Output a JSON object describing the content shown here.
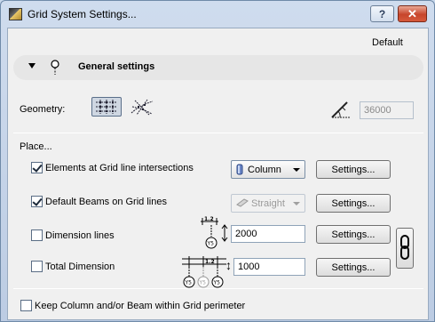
{
  "window": {
    "title": "Grid System Settings...",
    "help_label": "?",
    "close_label": "✕"
  },
  "header": {
    "default_label": "Default"
  },
  "section": {
    "title": "General settings"
  },
  "geometry": {
    "label": "Geometry:",
    "angle_value": "36000"
  },
  "place": {
    "label": "Place...",
    "elements_intersections": {
      "label": "Elements at Grid line intersections",
      "checked": true,
      "type_value": "Column",
      "settings_label": "Settings..."
    },
    "default_beams": {
      "label": "Default Beams on Grid lines",
      "checked": true,
      "type_value": "Straight",
      "settings_label": "Settings..."
    },
    "dimension_lines": {
      "label": "Dimension lines",
      "checked": false,
      "offset_value": "2000",
      "settings_label": "Settings...",
      "icon_dim": "1.2",
      "icon_tag": "Y5"
    },
    "total_dimension": {
      "label": "Total Dimension",
      "checked": false,
      "offset_value": "1000",
      "settings_label": "Settings...",
      "icon_dim": "1.2",
      "icon_tag": "Y5"
    }
  },
  "keep_within": {
    "label": "Keep Column and/or Beam within Grid perimeter",
    "checked": false
  },
  "colors": {
    "accent": "#c7452b",
    "panel": "#f0f0f0",
    "frame": "#bccce3"
  },
  "icons": [
    "app-icon",
    "help-icon",
    "close-icon",
    "collapse-triangle-icon",
    "pin-icon",
    "orthogonal-grid-icon",
    "polar-grid-icon",
    "angle-icon",
    "column-icon",
    "beam-icon",
    "dimension-icon",
    "total-dimension-icon",
    "chain-link-icon"
  ]
}
